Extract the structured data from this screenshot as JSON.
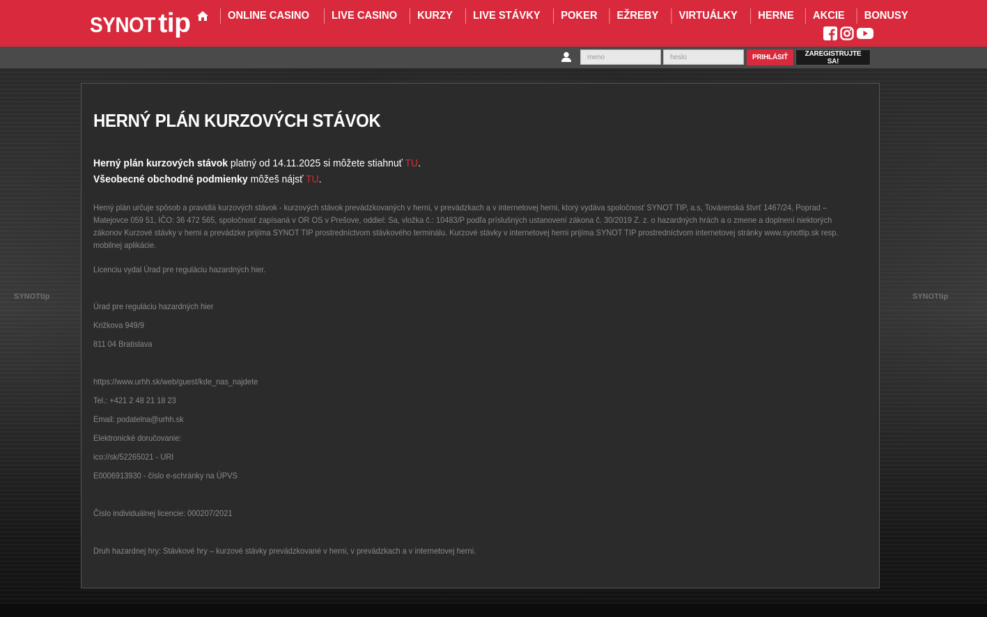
{
  "header": {
    "logo": {
      "synot": "SYNOT",
      "tip": "tip"
    },
    "nav": [
      {
        "label": "ONLINE CASINO"
      },
      {
        "label": "LIVE CASINO"
      },
      {
        "label": "KURZY"
      },
      {
        "label": "LIVE STÁVKY"
      },
      {
        "label": "POKER"
      },
      {
        "label": "EŽREBY"
      },
      {
        "label": "VIRTUÁLKY"
      },
      {
        "label": "HERNE"
      },
      {
        "label": "AKCIE"
      },
      {
        "label": "BONUSY"
      }
    ],
    "social": [
      "facebook-icon",
      "instagram-icon",
      "youtube-icon"
    ]
  },
  "login": {
    "username_placeholder": "meno",
    "password_placeholder": "heslo",
    "login_label": "PRIHLÁSIŤ",
    "register_label": "ZAREGISTRUJTE SA!"
  },
  "watermark": "SYNOTtip",
  "content": {
    "title": "HERNÝ PLÁN KURZOVÝCH STÁVOK",
    "lead1": {
      "bold": "Herný plán kurzových stávok",
      "text": " platný od 14.11.2025 si môžete stiahnuť ",
      "link": "TU",
      "end": "."
    },
    "lead2": {
      "bold": "Všeobecné obchodné podmienky",
      "text": " môžeš nájsť ",
      "link": "TU",
      "end": "."
    },
    "paragraph": "Herný plán určuje spôsob a pravidlá kurzových stávok  - kurzových stávok prevádzkovaných v herni, v prevádzkach a v internetovej herni, ktorý vydáva spoločnosť SYNOT TIP, a.s, Továrenská štvrť 1467/24, Poprad – Matejovce 059 51, IČO: 36 472 565, spoločnosť zapísaná v OR OS v Prešove, oddiel: Sa, vložka č.: 10483/P podľa príslušných ustanovení zákona č. 30/2019 Z. z. o hazardných hrách a o zmene a doplnení niektorých zákonov Kurzové stávky v herni a prevádzke prijíma SYNOT TIP  prostredníctvom stávkového terminálu. Kurzové stávky v internetovej herni prijíma SYNOT TIP prostredníctvom internetovej stránky www.synottip.sk resp. mobilnej aplikácie.",
    "license_issuer": "Licenciu vydal Úrad pre reguláciu hazardných hier.",
    "office_name": "Úrad pre reguláciu hazardných hier",
    "office_street": "Križkova 949/9",
    "office_city": "811 04 Bratislava",
    "office_url": "https://www.urhh.sk/web/guest/kde_nas_najdete",
    "office_phone": "Tel.: +421 2 48 21 18 23",
    "office_email": "Email: podatelna@urhh.sk",
    "edelivery_label": "Elektronické doručovanie:",
    "edelivery_uri": "ico://sk/52265021 - URI",
    "edelivery_box": "E0006913930 - číslo e-schránky na ÚPVS",
    "license_number": "Číslo individuálnej licencie: 000207/2021",
    "game_type": "Druh hazardnej hry: Stávkové hry – kurzové stávky prevádzkované v herni, v prevádzkach a v internetovej herni."
  }
}
